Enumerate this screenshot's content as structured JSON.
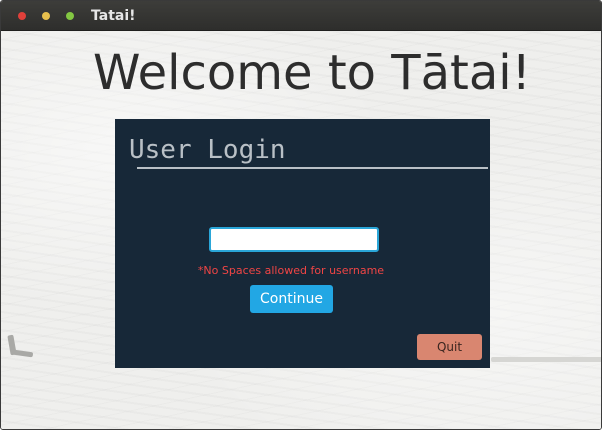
{
  "window": {
    "title": "Tatai!",
    "controls": {
      "close_color": "#e0403a",
      "minimize_color": "#e8c04d",
      "maximize_color": "#83c742"
    }
  },
  "main": {
    "welcome_text": "Welcome to Tātai!"
  },
  "login": {
    "title": "User Login",
    "username": {
      "value": "",
      "placeholder": ""
    },
    "error_message": "*No Spaces allowed for username",
    "continue_label": "Continue",
    "quit_label": "Quit"
  },
  "colors": {
    "panel_background": "#172838",
    "continue_button": "#22a7e4",
    "quit_button": "#d98670",
    "error_text": "#f04545",
    "input_focus_border": "#2aa6d8"
  }
}
